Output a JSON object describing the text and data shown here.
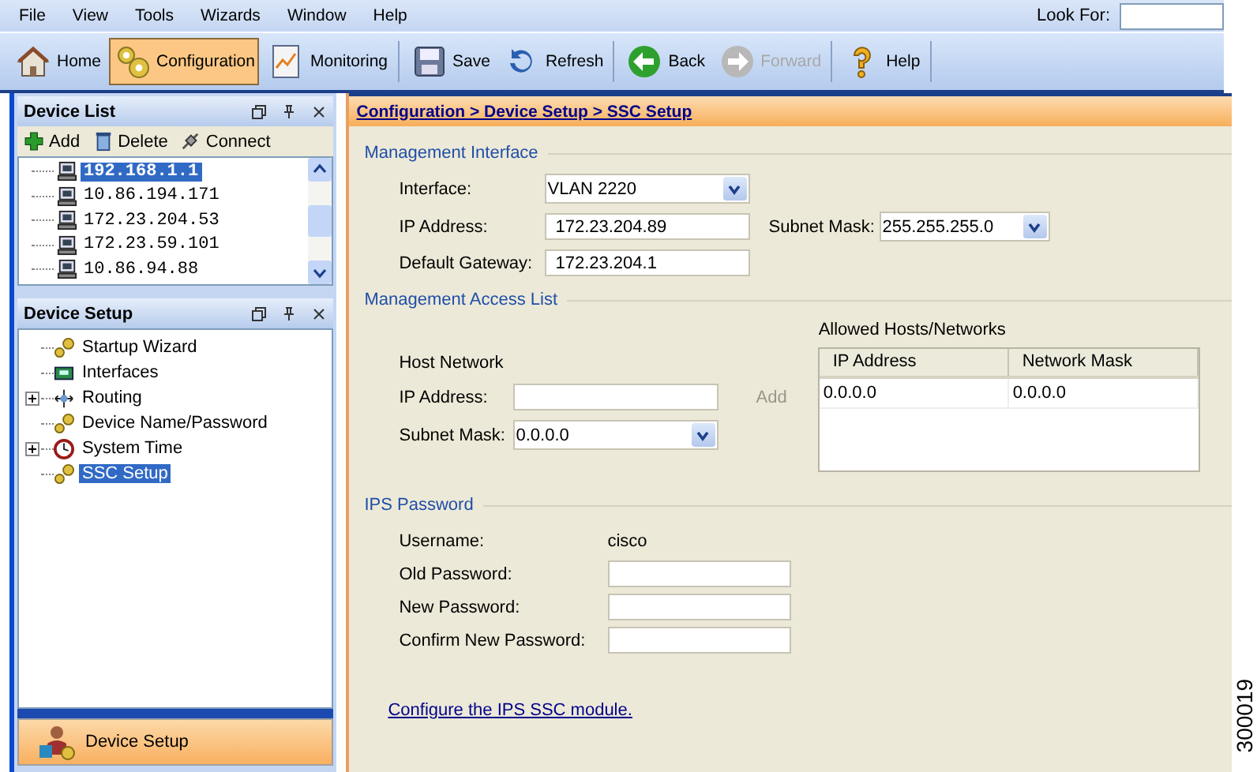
{
  "menu": [
    "File",
    "View",
    "Tools",
    "Wizards",
    "Window",
    "Help"
  ],
  "look_for": {
    "label": "Look For:"
  },
  "toolbar": {
    "groups": [
      [
        {
          "label": "Home",
          "selected": false,
          "disabled": false
        },
        {
          "label": "Configuration",
          "selected": true,
          "disabled": false
        },
        {
          "label": "Monitoring",
          "selected": false,
          "disabled": false
        }
      ],
      [
        {
          "label": "Save",
          "selected": false,
          "disabled": false
        },
        {
          "label": "Refresh",
          "selected": false,
          "disabled": false
        }
      ],
      [
        {
          "label": "Back",
          "selected": false,
          "disabled": false
        },
        {
          "label": "Forward",
          "selected": false,
          "disabled": true
        }
      ],
      [
        {
          "label": "Help",
          "selected": false,
          "disabled": false
        }
      ]
    ]
  },
  "device_list": {
    "title": "Device List",
    "actions": [
      "Add",
      "Delete",
      "Connect"
    ],
    "items": [
      {
        "label": "192.168.1.1",
        "selected": true
      },
      {
        "label": "10.86.194.171",
        "selected": false
      },
      {
        "label": "172.23.204.53",
        "selected": false
      },
      {
        "label": "172.23.59.101",
        "selected": false
      },
      {
        "label": "10.86.94.88",
        "selected": false
      }
    ]
  },
  "device_setup": {
    "title": "Device Setup",
    "items": [
      {
        "label": "Startup Wizard",
        "kind": "wizard",
        "selected": false
      },
      {
        "label": "Interfaces",
        "kind": "interfaces",
        "selected": false
      },
      {
        "label": "Routing",
        "kind": "routing",
        "expanded": false,
        "selected": false
      },
      {
        "label": "Device Name/Password",
        "kind": "wizard",
        "selected": false
      },
      {
        "label": "System Time",
        "kind": "clock",
        "expanded": false,
        "selected": false
      },
      {
        "label": "SSC Setup",
        "kind": "wizard",
        "selected": true
      }
    ]
  },
  "nav_buttons": [
    {
      "label": "Device Setup",
      "selected": true
    }
  ],
  "breadcrumb": "Configuration > Device Setup > SSC Setup",
  "management_interface": {
    "title": "Management Interface",
    "interface": {
      "label": "Interface:",
      "value": "VLAN 2220"
    },
    "ip_address": {
      "label": "IP Address:",
      "value": "172.23.204.89"
    },
    "subnet_mask": {
      "label": "Subnet Mask:",
      "value": "255.255.255.0"
    },
    "default_gateway": {
      "label": "Default Gateway:",
      "value": "172.23.204.1"
    }
  },
  "management_access_list": {
    "title": "Management Access List",
    "host_network": "Host Network",
    "ip_address": {
      "label": "IP Address:"
    },
    "subnet_mask": {
      "label": "Subnet Mask:",
      "value": "0.0.0.0"
    },
    "add_button": {
      "label": "Add",
      "disabled": true
    },
    "allowed_title": "Allowed Hosts/Networks",
    "table": {
      "columns": [
        "IP Address",
        "Network Mask"
      ],
      "rows": [
        [
          "0.0.0.0",
          "0.0.0.0"
        ]
      ]
    }
  },
  "ips_password": {
    "title": "IPS Password",
    "username": {
      "label": "Username:",
      "value": "cisco"
    },
    "fields": [
      {
        "label": "Old Password:"
      },
      {
        "label": "New Password:"
      },
      {
        "label": "Confirm New Password:"
      }
    ]
  },
  "configure_link": "Configure the IPS SSC module.",
  "figure_id": "300019"
}
